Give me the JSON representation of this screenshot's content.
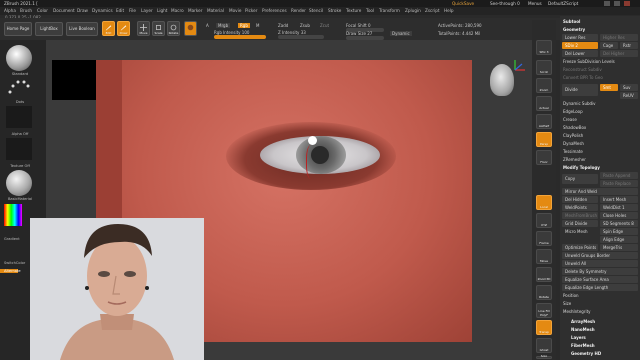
{
  "title_bar": {
    "app_title": "ZBrush 2021.1 [",
    "quicksave": "QuickSave",
    "see_through": "See-through 0",
    "menus": "Menus",
    "default_script": "DefaultZScript"
  },
  "menu_bar": {
    "items": [
      "Alpha",
      "Brush",
      "Color",
      "Document",
      "Draw",
      "Dynamics",
      "Edit",
      "File",
      "Layer",
      "Light",
      "Macro",
      "Marker",
      "Material",
      "Movie",
      "Picker",
      "Preferences",
      "Render",
      "Stencil",
      "Stroke",
      "Texture",
      "Tool",
      "Transform",
      "Zplugin",
      "Zscript",
      "Help"
    ]
  },
  "coordinates": "0.373,0.25,-1.082",
  "toolbar": {
    "home_page": "Home Page",
    "lightbox": "LightBox",
    "live_boolean": "Live Boolean",
    "edit": "Edit",
    "draw": "Draw",
    "move": "Move",
    "scale": "Scale",
    "rotate": "Rotate",
    "a_label": "A",
    "mrgb": "Mrgb",
    "rgb": "Rgb",
    "m_label": "M",
    "zadd": "Zadd",
    "zsub": "Zsub",
    "zcut": "Zcut",
    "rgb_intensity": "Rgb Intensity 100",
    "z_intensity": "Z Intensity 33",
    "focal_shift": "Focal Shift 0",
    "draw_size": "Draw Size 27",
    "dynamic": "Dynamic",
    "active_points": "ActivePoints: 280,590",
    "total_points": "TotalPoints: 4.442 Mil"
  },
  "left_shelf": {
    "brush_label": "Standard",
    "stroke_label": "Dots",
    "alpha_label": "Alpha Off",
    "texture_label": "Texture Off",
    "material_label": "BasicMaterial",
    "gradient_label": "Gradient",
    "switch_color": "SwitchColor",
    "alternate": "Alternate"
  },
  "right_column": {
    "buttons": [
      "SPix 3",
      "Scroll",
      "Zoom",
      "Actual",
      "AAHalf",
      "Persp",
      "Floor",
      "Local",
      "XYZ",
      "Frame",
      "Move",
      "Zoom3D",
      "Rotate",
      "Line Fill PolyF",
      "Transp",
      "Ghost",
      "Solo",
      "Xpose"
    ]
  },
  "palette": {
    "subtool": "Subtool",
    "geometry": "Geometry",
    "lower_res": "Lower Res",
    "higher_res": "Higher Res",
    "sdiv": "SDiv 2",
    "cage": "Cage",
    "rstr": "Rstr",
    "del_lower": "Del Lower",
    "del_higher": "Del Higher",
    "freeze_subdiv": "Freeze SubDivision Levels",
    "reconstruct": "Reconstruct Subdiv",
    "convert_bpr": "Convert BPR To Geo",
    "divide": "Divide",
    "smt": "Smt",
    "suv": "Suv",
    "rsuv": "ReUV",
    "dynamic_subdiv": "Dynamic Subdiv",
    "edgeloop": "EdgeLoop",
    "crease": "Crease",
    "shadowbox": "ShadowBox",
    "claypolish": "ClayPolish",
    "dynamesh": "DynaMesh",
    "tessimate": "Tessimate",
    "zremesher": "ZRemesher",
    "modify_topology": "Modify Topology",
    "copy": "Copy",
    "paste_append": "Paste Append",
    "paste_replace": "Paste Replace",
    "mirror_and_weld": "Mirror And Weld",
    "del_hidden": "Del Hidden",
    "insert_mesh": "Insert Mesh",
    "weldpoints": "WeldPoints",
    "weld_dist": "WeldDist 1",
    "mesh_from_brush": "MeshFromBrush",
    "close_holes": "Close Holes",
    "grid_divide": "Grid Divide",
    "sd_segments": "SD Segments 8",
    "micro_mesh": "Micro Mesh",
    "spin_edge": "Spin Edge",
    "align_edge": "Align Edge",
    "optimize_points": "Optimize Points",
    "merge_tris": "MergeTris",
    "unweld_groups_border": "Unweld Groups Border",
    "unweld_all": "Unweld All",
    "delete_by_symmetry": "Delete By Symmetry",
    "equalize_surface_area": "Equalize Surface Area",
    "equalize_edge_length": "Equalize Edge Length",
    "position": "Position",
    "size": "Size",
    "mesh_integrity": "MeshIntegrity",
    "array_mesh": "ArrayMesh",
    "nano_mesh": "NanoMesh",
    "layers": "Layers",
    "fiber_mesh": "FiberMesh",
    "geometry_hd": "Geometry HD"
  },
  "colors": {
    "accent_orange": "#e48a12",
    "model_skin": "#c05a4c",
    "ui_background": "#2a2a2a"
  }
}
